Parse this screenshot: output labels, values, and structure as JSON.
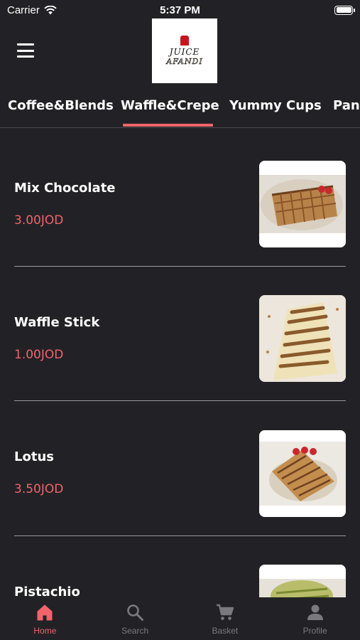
{
  "status_bar": {
    "carrier": "Carrier",
    "time": "5:37 PM"
  },
  "header": {
    "logo_line1": "JUICE",
    "logo_line2": "AFANDI"
  },
  "tabs": [
    {
      "label": "Coffee&Blends"
    },
    {
      "label": "Waffle&Crepe",
      "active": true
    },
    {
      "label": "Yummy Cups"
    },
    {
      "label": "Panc"
    }
  ],
  "products": [
    {
      "name": "Mix Chocolate",
      "price": "3.00JOD"
    },
    {
      "name": "Waffle Stick",
      "price": "1.00JOD"
    },
    {
      "name": "Lotus",
      "price": "3.50JOD"
    },
    {
      "name": "Pistachio",
      "price": ""
    }
  ],
  "bottom_nav": [
    {
      "label": "Home",
      "icon": "home-icon",
      "active": true
    },
    {
      "label": "Search",
      "icon": "search-icon"
    },
    {
      "label": "Basket",
      "icon": "cart-icon"
    },
    {
      "label": "Profile",
      "icon": "profile-icon"
    }
  ],
  "colors": {
    "background": "#222226",
    "accent": "#f0646a",
    "inactive": "#7a7a7e"
  }
}
